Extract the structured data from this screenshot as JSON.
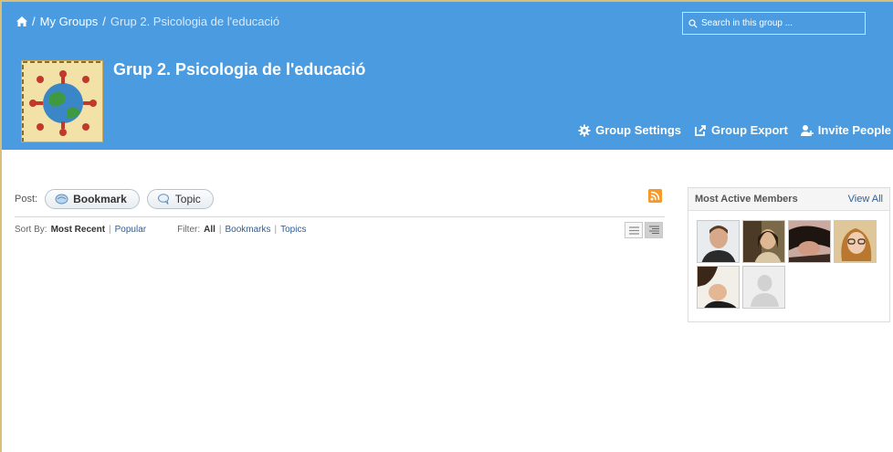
{
  "breadcrumb": {
    "sep": "/",
    "my_groups": "My Groups",
    "current": "Grup 2. Psicologia de l'educació"
  },
  "search": {
    "placeholder": "Search in this group ..."
  },
  "group": {
    "title": "Grup 2. Psicologia de l'educació"
  },
  "actions": {
    "settings": "Group Settings",
    "export": "Group Export",
    "invite": "Invite People"
  },
  "post": {
    "label": "Post:",
    "bookmark": "Bookmark",
    "topic": "Topic"
  },
  "sort": {
    "label": "Sort By:",
    "most_recent": "Most Recent",
    "popular": "Popular",
    "filter_label": "Filter:",
    "all": "All",
    "bookmarks": "Bookmarks",
    "topics": "Topics",
    "pipe": "|"
  },
  "members": {
    "title": "Most Active Members",
    "view_all": "View All",
    "avatars": [
      "member-1",
      "member-2",
      "member-3",
      "member-4",
      "member-5",
      "member-6"
    ]
  },
  "colors": {
    "header_bg": "#4a9be0",
    "link": "#2a5f9a",
    "rss": "#f59a2b"
  }
}
